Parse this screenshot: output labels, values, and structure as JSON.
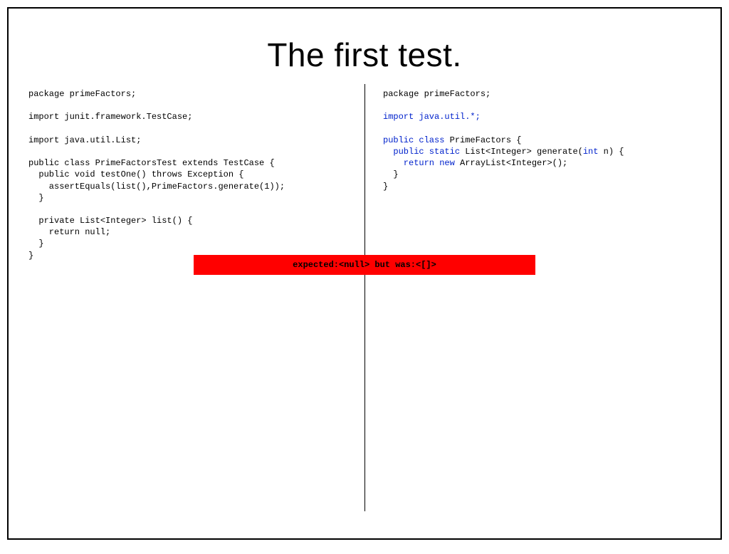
{
  "title": "The first test.",
  "left_code": {
    "l1": "package primeFactors;",
    "l2": "",
    "l3": "import junit.framework.TestCase;",
    "l4": "",
    "l5": "import java.util.List;",
    "l6": "",
    "l7": "public class PrimeFactorsTest extends TestCase {",
    "l8": "  public void testOne() throws Exception {",
    "l9": "    assertEquals(list(),PrimeFactors.generate(1));",
    "l10": "  }",
    "l11": "",
    "l12": "  private List<Integer> list() {",
    "l13": "    return null;",
    "l14": "  }",
    "l15": "}"
  },
  "right_code": {
    "l1": "package primeFactors;",
    "l2": "",
    "l3": "import java.util.*;",
    "l4": "",
    "l5a": "public class",
    "l5b": " PrimeFactors {",
    "l6a": "  public static",
    "l6b": " List<Integer> generate(",
    "l6c": "int",
    "l6d": " n) {",
    "l7a": "    return new",
    "l7b": " ArrayList<Integer>();",
    "l8": "  }",
    "l9": "}"
  },
  "error_message": "expected:<null> but was:<[]>",
  "colors": {
    "keyword": "#0022cc",
    "error_bg": "#ff0000"
  }
}
